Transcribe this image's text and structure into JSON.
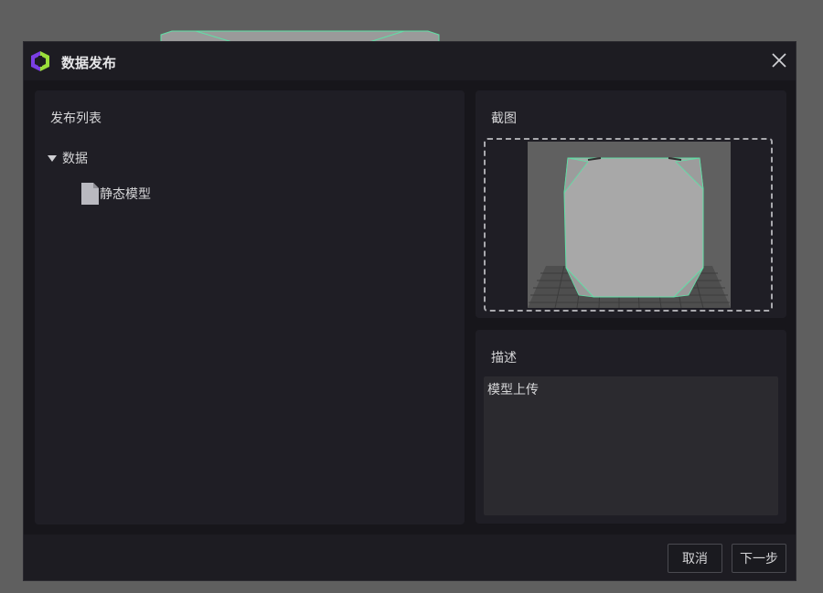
{
  "dialog": {
    "title": "数据发布"
  },
  "publish_list": {
    "title": "发布列表",
    "tree": {
      "node_label": "数据",
      "children": [
        {
          "label": "静态模型"
        }
      ]
    }
  },
  "screenshot": {
    "title": "截图"
  },
  "description": {
    "title": "描述",
    "value": "模型上传"
  },
  "footer": {
    "cancel_label": "取消",
    "next_label": "下一步"
  },
  "colors": {
    "accent_green": "#5fe0a6",
    "logo_purple": "#7b3fe4",
    "logo_green": "#9ade3a"
  }
}
